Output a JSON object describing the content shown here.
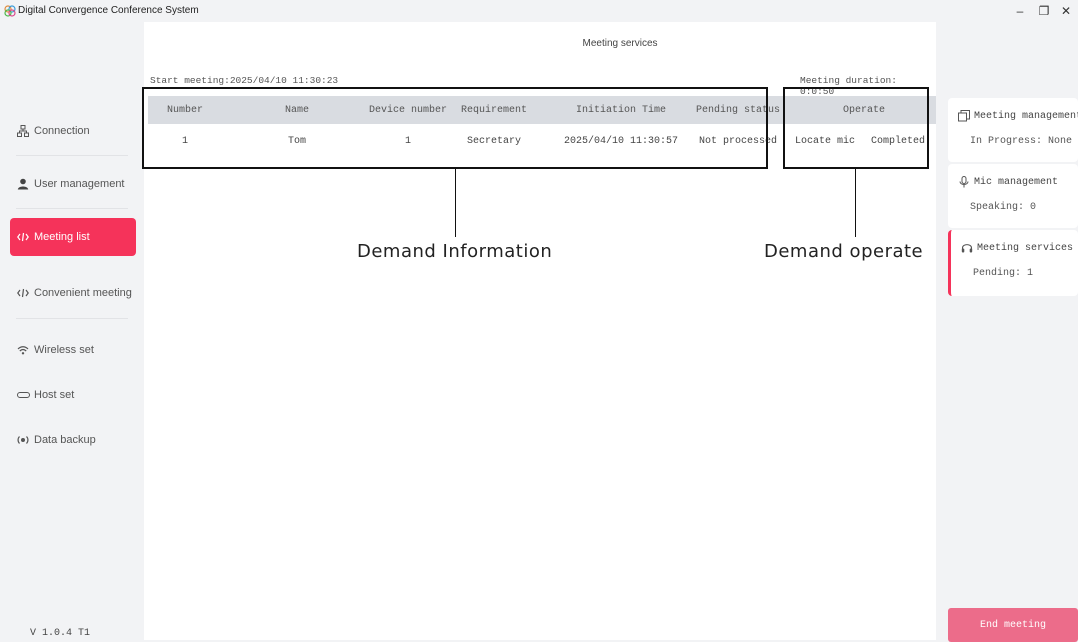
{
  "window": {
    "title": "Digital Convergence Conference System",
    "minimize": "–",
    "restore": "❐",
    "close": "✕"
  },
  "sidebar": {
    "items": [
      {
        "label": "Connection",
        "icon": "connection-icon"
      },
      {
        "label": "User management",
        "icon": "user-icon"
      },
      {
        "label": "Meeting list",
        "icon": "meeting-list-icon",
        "active": true
      },
      {
        "label": "Convenient meeting",
        "icon": "convenient-meeting-icon"
      },
      {
        "label": "Wireless set",
        "icon": "wifi-icon"
      },
      {
        "label": "Host set",
        "icon": "host-icon"
      },
      {
        "label": "Data backup",
        "icon": "backup-icon"
      }
    ],
    "version": "V 1.0.4 T1"
  },
  "main": {
    "title": "Meeting services",
    "start_meeting": "Start meeting:2025/04/10 11:30:23",
    "duration": "Meeting duration: 0:0:50",
    "table": {
      "headers": [
        "Number",
        "Name",
        "Device number",
        "Requirement",
        "Initiation Time",
        "Pending status",
        "Operate"
      ],
      "rows": [
        {
          "number": "1",
          "name": "Tom",
          "device_number": "1",
          "requirement": "Secretary",
          "initiation_time": "2025/04/10 11:30:57",
          "pending_status": "Not processed",
          "actions": {
            "locate": "Locate mic",
            "completed": "Completed"
          }
        }
      ]
    }
  },
  "annotations": {
    "demand_information": "Demand Information",
    "demand_operate": "Demand operate"
  },
  "right_panel": {
    "meeting_management": {
      "title": "Meeting management",
      "value": "In Progress: None"
    },
    "mic_management": {
      "title": "Mic management",
      "value": "Speaking: 0"
    },
    "meeting_services": {
      "title": "Meeting services",
      "value": "Pending: 1"
    },
    "end_button": "End meeting"
  },
  "colors": {
    "accent": "#f5335a",
    "end_button": "#ec6c8a",
    "locate_link": "#1aaa3a",
    "completed_link": "#3a78c9"
  }
}
